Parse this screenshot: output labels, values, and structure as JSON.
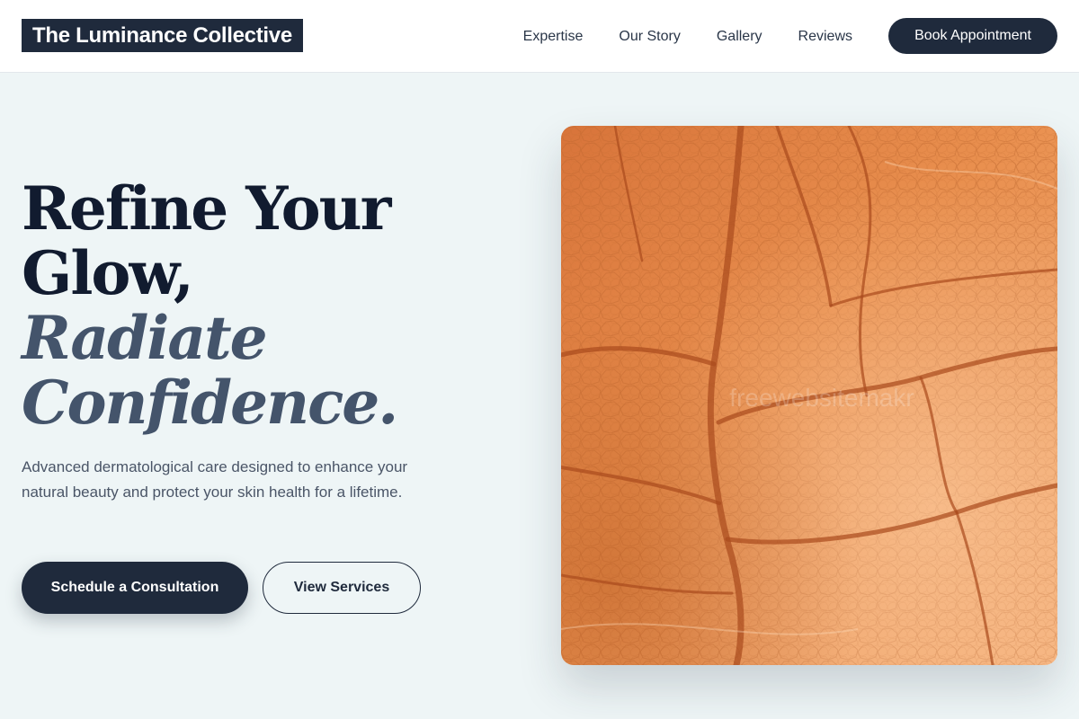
{
  "brand": {
    "name": "The Luminance Collective"
  },
  "nav": {
    "links": [
      {
        "label": "Expertise"
      },
      {
        "label": "Our Story"
      },
      {
        "label": "Gallery"
      },
      {
        "label": "Reviews"
      }
    ],
    "cta_label": "Book Appointment"
  },
  "hero": {
    "headline_line1": "Refine Your",
    "headline_line2": "Glow,",
    "headline_accent1": "Radiate",
    "headline_accent2": "Confidence.",
    "description": "Advanced dermatological care designed to enhance your natural beauty and protect your skin health for a lifetime.",
    "primary_cta": "Schedule a Consultation",
    "secondary_cta": "View Services",
    "image_watermark": "freewebsitemakr"
  },
  "colors": {
    "brand_navy": "#1f2a3c",
    "background": "#eef5f6",
    "headline_dark": "#111b2f",
    "headline_accent": "#44546b",
    "image_orange": "#e88a45"
  }
}
